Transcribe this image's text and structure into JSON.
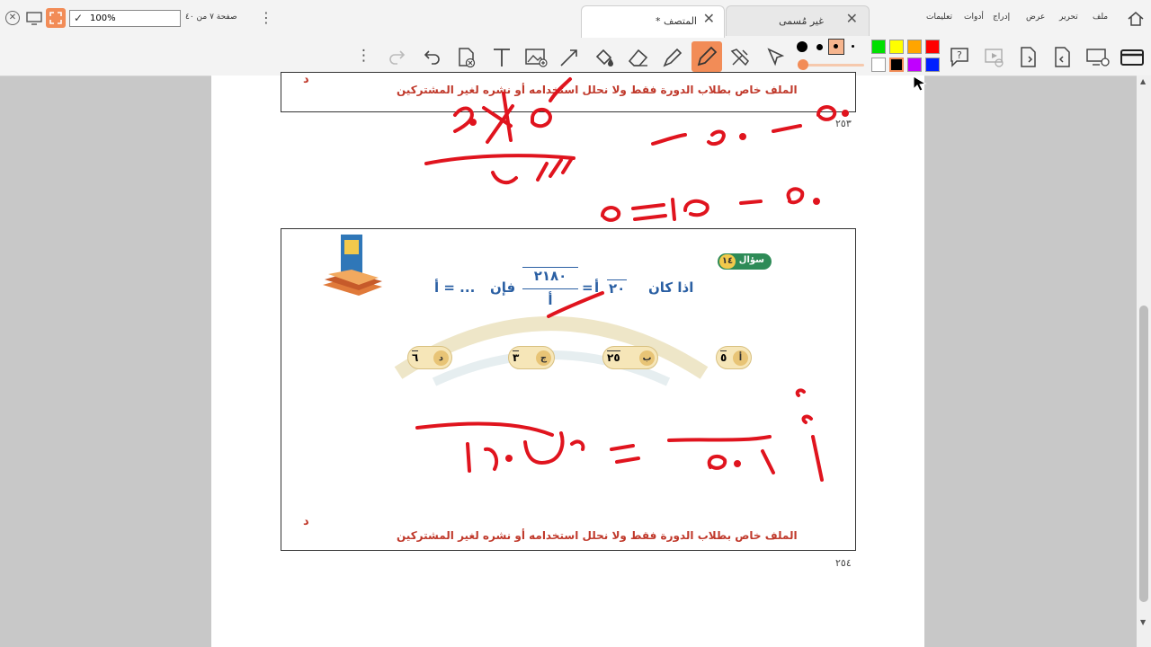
{
  "tabs": [
    {
      "label": "المتصف *",
      "close": "✕"
    },
    {
      "label": "غير مُسمى",
      "close": "✕"
    }
  ],
  "menu": [
    "ملف",
    "تحرير",
    "عرض",
    "إدراج",
    "أدوات",
    "تعليمات"
  ],
  "page_indicator": "صفحة ٧ من ٤٠",
  "zoom": "100%",
  "question": {
    "badge": "سؤال",
    "number": "١٤",
    "stem_prefix": "اذا كان",
    "coef": "٢٠",
    "var": "أ",
    "numerator": "١٨٠",
    "numerator_coef": "٢",
    "denominator": "أ",
    "then": "فإن",
    "result": "أ = ...",
    "options": [
      {
        "letter": "أ",
        "value": "٥"
      },
      {
        "letter": "ب",
        "value": "٢٥"
      },
      {
        "letter": "ج",
        "value": "٣"
      },
      {
        "letter": "د",
        "value": "٦"
      }
    ]
  },
  "footer_note": "الملف خاص بطلاب الدورة فقط ولا نحلل استخدامه أو نشره لغير المشتركين",
  "footer_corner": "د",
  "page_num_top": "٢٥٣",
  "page_num_bottom": "٢٥٤",
  "colors": {
    "ink": "#e0141e",
    "accent": "#f28c57"
  },
  "palette": [
    "#00e000",
    "#ffff00",
    "#ffa500",
    "#ff0000",
    "#ffffff",
    "#000000",
    "#c000ff",
    "#0020ff"
  ]
}
